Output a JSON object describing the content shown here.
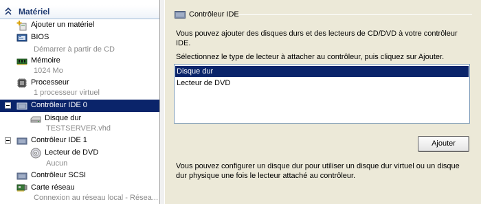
{
  "tree": {
    "header": "Matériel",
    "items": [
      {
        "label": "Ajouter un matériel",
        "sub": "",
        "icon": "add-hardware-icon"
      },
      {
        "label": "BIOS",
        "sub": "Démarrer à partir de CD",
        "icon": "bios-icon"
      },
      {
        "label": "Mémoire",
        "sub": "1024 Mo",
        "icon": "memory-icon"
      },
      {
        "label": "Processeur",
        "sub": "1 processeur virtuel",
        "icon": "processor-icon"
      },
      {
        "label": "Contrôleur IDE 0",
        "sub": "",
        "icon": "ide-controller-icon"
      },
      {
        "label": "Disque dur",
        "sub": "TESTSERVER.vhd",
        "icon": "hard-disk-icon"
      },
      {
        "label": "Contrôleur IDE 1",
        "sub": "",
        "icon": "ide-controller-icon"
      },
      {
        "label": "Lecteur de DVD",
        "sub": "Aucun",
        "icon": "dvd-icon"
      },
      {
        "label": "Contrôleur SCSI",
        "sub": "",
        "icon": "scsi-controller-icon"
      },
      {
        "label": "Carte réseau",
        "sub": "Connexion au réseau local - Résea...",
        "icon": "network-adapter-icon"
      }
    ]
  },
  "panel": {
    "title": "Contrôleur IDE",
    "intro": "Vous pouvez ajouter des disques durs et des lecteurs de CD/DVD à votre contrôleur IDE.",
    "select_prompt": "Sélectionnez le type de lecteur à attacher au contrôleur, puis cliquez sur Ajouter.",
    "options": [
      "Disque dur",
      "Lecteur de DVD"
    ],
    "selected_option": "Disque dur",
    "add_label": "Ajouter",
    "footer": "Vous pouvez configurer un disque dur pour utiliser un disque dur virtuel ou un disque dur physique une fois le lecteur attaché au contrôleur."
  },
  "colors": {
    "selection": "#0a246a",
    "header_text": "#1e3970",
    "subtext": "#8a8a8a"
  }
}
